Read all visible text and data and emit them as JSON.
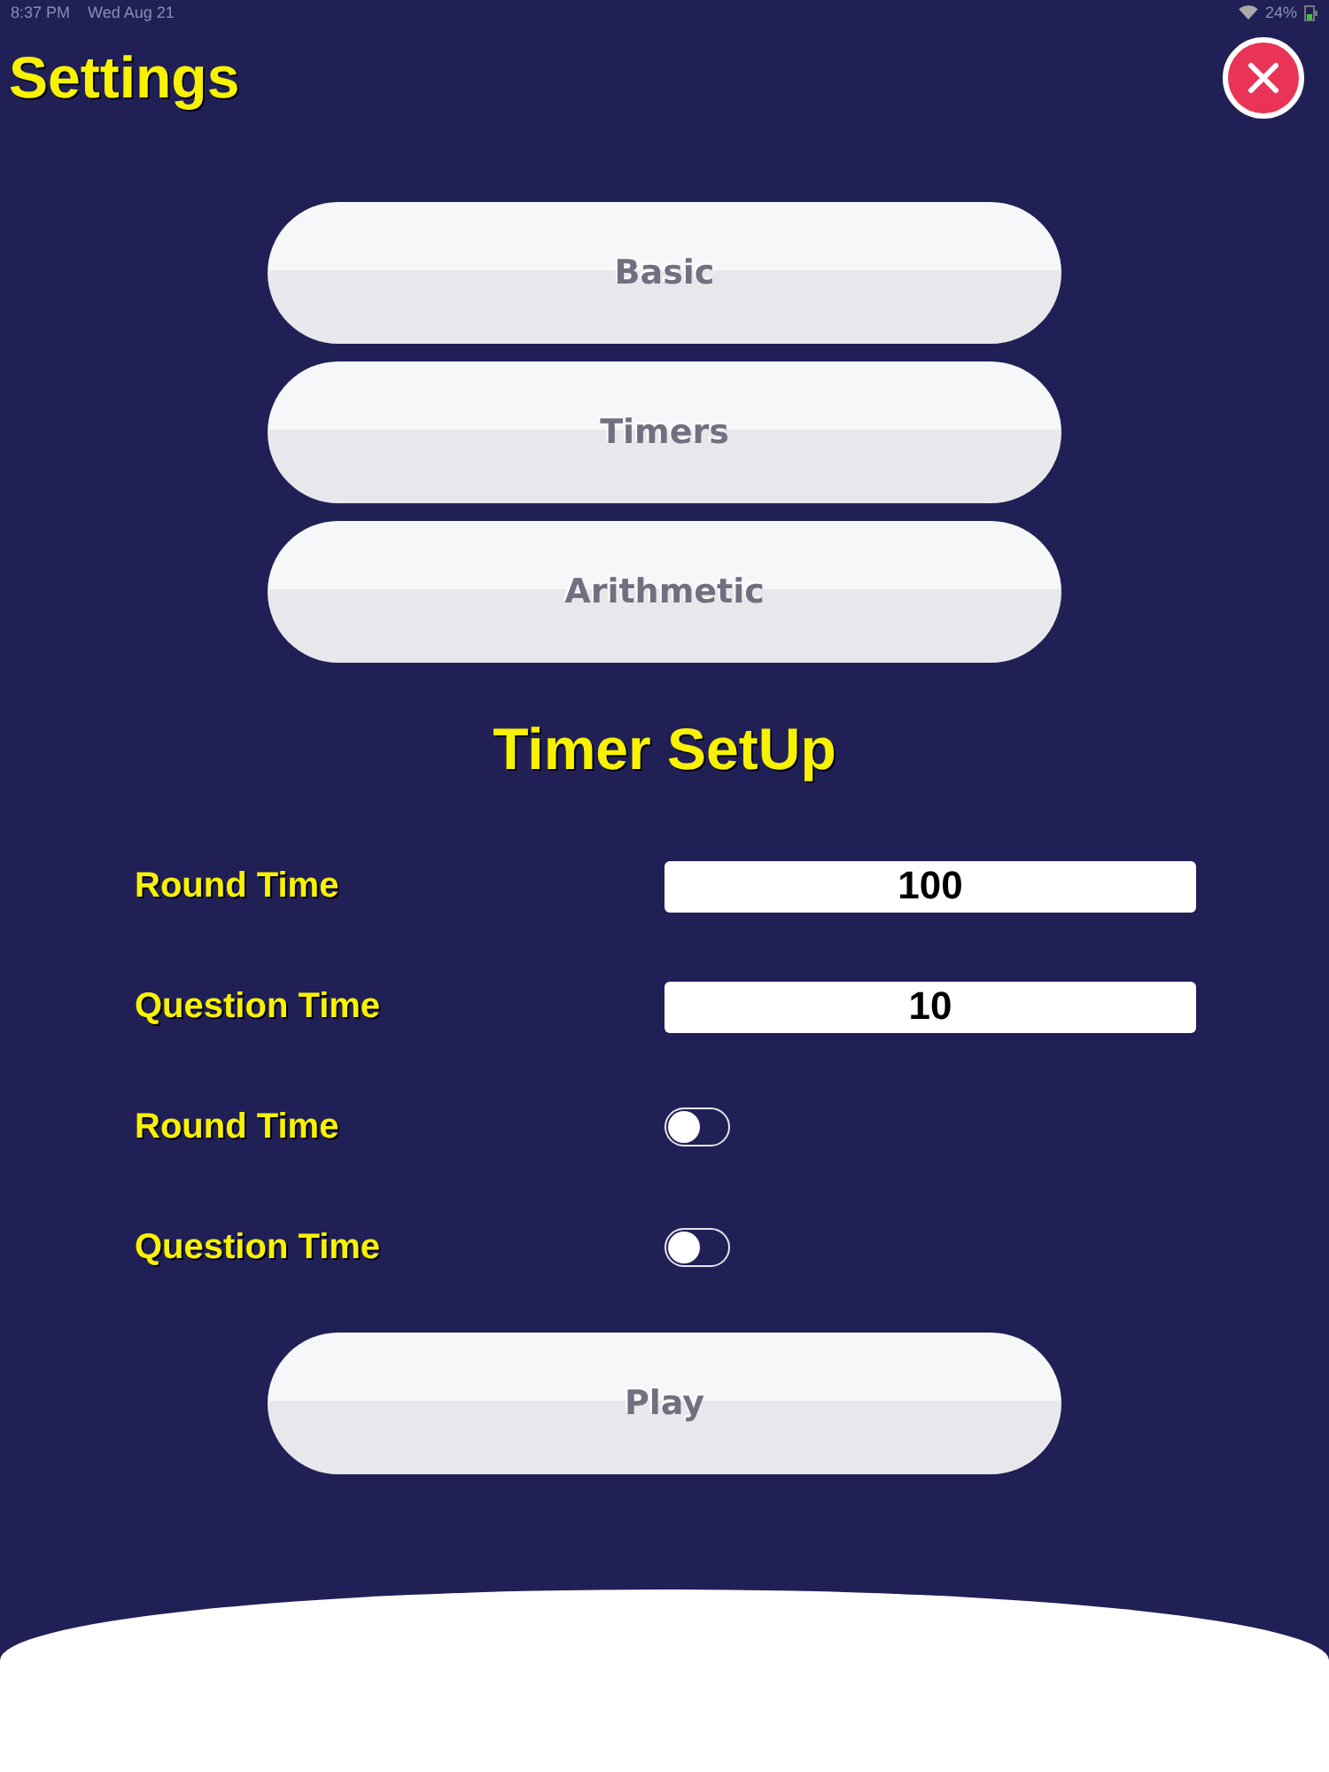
{
  "status_bar": {
    "time": "8:37 PM",
    "date": "Wed Aug 21",
    "battery": "24%"
  },
  "header": {
    "title": "Settings"
  },
  "menu_buttons": [
    {
      "label": "Basic"
    },
    {
      "label": "Timers"
    },
    {
      "label": "Arithmetic"
    }
  ],
  "section_title": "Timer SetUp",
  "settings": [
    {
      "kind": "field",
      "label": "Round Time",
      "value": "100"
    },
    {
      "kind": "field",
      "label": "Question Time",
      "value": "10"
    },
    {
      "kind": "toggle",
      "label": "Round Time",
      "on": false
    },
    {
      "kind": "toggle",
      "label": "Question Time",
      "on": false
    }
  ],
  "play_button": {
    "label": "Play"
  }
}
